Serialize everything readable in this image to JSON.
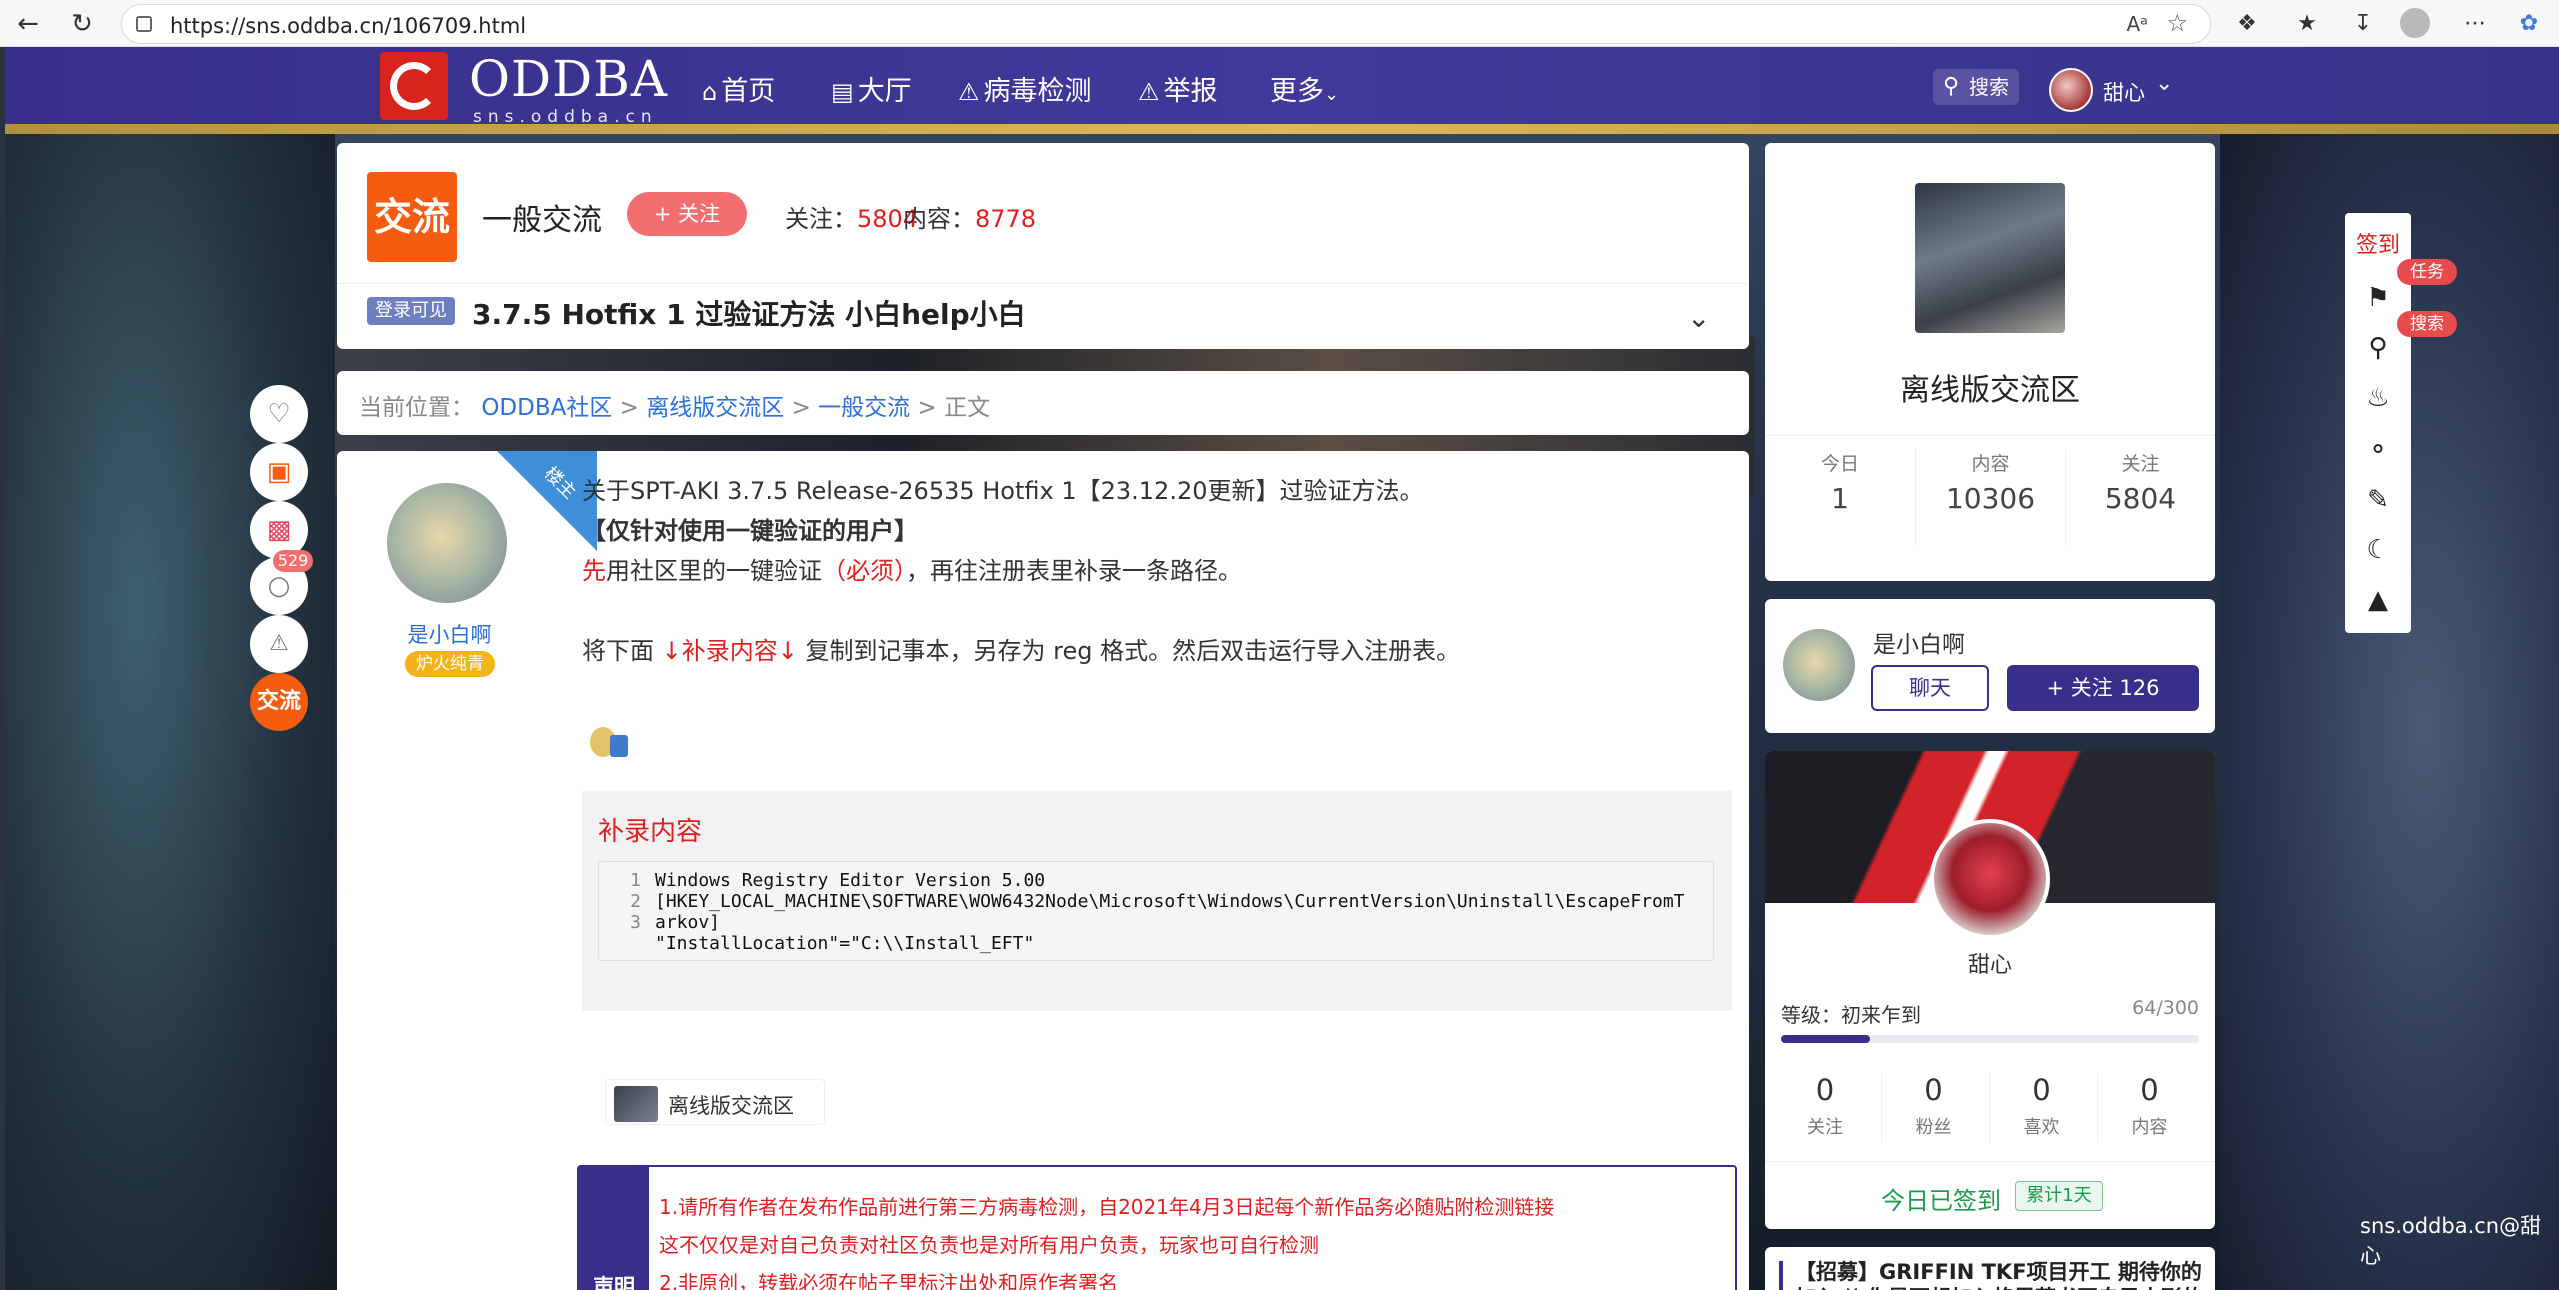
{
  "browser": {
    "url": "https://sns.oddba.cn/106709.html",
    "read_aloud": "Aᵃ"
  },
  "header": {
    "logo_text": "ODDBA",
    "logo_sub": "sns.oddba.cn",
    "nav": [
      {
        "label": "首页",
        "icon": "home-icon"
      },
      {
        "label": "大厅",
        "icon": "hall-icon"
      },
      {
        "label": "病毒检测",
        "icon": "warning-icon"
      },
      {
        "label": "举报",
        "icon": "report-icon"
      },
      {
        "label": "更多",
        "icon": "chevron-down-icon"
      }
    ],
    "search_label": "搜索",
    "user_name": "甜心"
  },
  "forum": {
    "icon_text": "交流",
    "name": "一般交流",
    "follow_label": "+ 关注",
    "followers_label": "关注：",
    "followers": "5804",
    "content_label": "内容：",
    "content_count": "8778",
    "login_badge": "登录可见",
    "post_title": "3.7.5 Hotfix 1 过验证方法 小白help小白"
  },
  "breadcrumb": {
    "prefix": "当前位置：",
    "items": [
      "ODDBA社区",
      "离线版交流区",
      "一般交流"
    ],
    "sep": ">",
    "current": "正文"
  },
  "post": {
    "corner_label": "楼主",
    "author": "是小白啊",
    "author_tag": "炉火纯青",
    "line1": "关于SPT-AKI 3.7.5 Release-26535 Hotfix 1【23.12.20更新】过验证方法。",
    "line2": "【仅针对使用一键验证的用户】",
    "line3a": "先",
    "line3b": "用社区里的一键验证",
    "line3c": "（必须）",
    "line3d": "，再往注册表里补录一条路径。",
    "line4a": "将下面 ",
    "line4b": "↓补录内容↓",
    "line4c": " 复制到记事本，另存为 reg 格式。然后双击运行导入注册表。",
    "code_title": "补录内容",
    "code_lines": [
      {
        "n": "1",
        "t": "Windows Registry Editor Version 5.00"
      },
      {
        "n": "2",
        "t": "[HKEY_LOCAL_MACHINE\\SOFTWARE\\WOW6432Node\\Microsoft\\Windows\\CurrentVersion\\Uninstall\\EscapeFromT"
      },
      {
        "n": "",
        "t": "arkov]"
      },
      {
        "n": "3",
        "t": "\"InstallLocation\"=\"C:\\\\Install_EFT\""
      }
    ],
    "forum_ref": "离线版交流区",
    "notice_side": "声明",
    "notice_lines": [
      "1.请所有作者在发布作品前进行第三方病毒检测，自2021年4月3日起每个新作品务必随贴附检测链接",
      "这不仅仅是对自己负责对社区负责也是对所有用户负责，玩家也可自行检测",
      "2.非原创，转载必须在帖子里标注出处和原作者署名"
    ]
  },
  "left_actions": {
    "comment_count": "529",
    "forum_badge": "交流"
  },
  "right": {
    "forum_title": "离线版交流区",
    "stats": [
      {
        "k": "今日",
        "v": "1"
      },
      {
        "k": "内容",
        "v": "10306"
      },
      {
        "k": "关注",
        "v": "5804"
      }
    ],
    "author_name": "是小白啊",
    "chat_label": "聊天",
    "follow_label": "+ 关注 126",
    "me_name": "甜心",
    "level_label": "等级：初来乍到",
    "exp": "64/300",
    "exp_fraction": 0.2133,
    "me_stats": [
      {
        "k": "关注",
        "v": "0"
      },
      {
        "k": "粉丝",
        "v": "0"
      },
      {
        "k": "喜欢",
        "v": "0"
      },
      {
        "k": "内容",
        "v": "0"
      }
    ],
    "signed": "今日已签到",
    "signed_tag": "累计1天",
    "recruit": "【招募】GRIFFIN TKF项目开工 期待你的加入 || 你是否想加入格里芬书写自己人形的故事"
  },
  "toolbar": {
    "checkin": "签到",
    "task_tag": "任务",
    "search_tag": "搜索"
  },
  "watermark": "sns.oddba.cn@甜心"
}
